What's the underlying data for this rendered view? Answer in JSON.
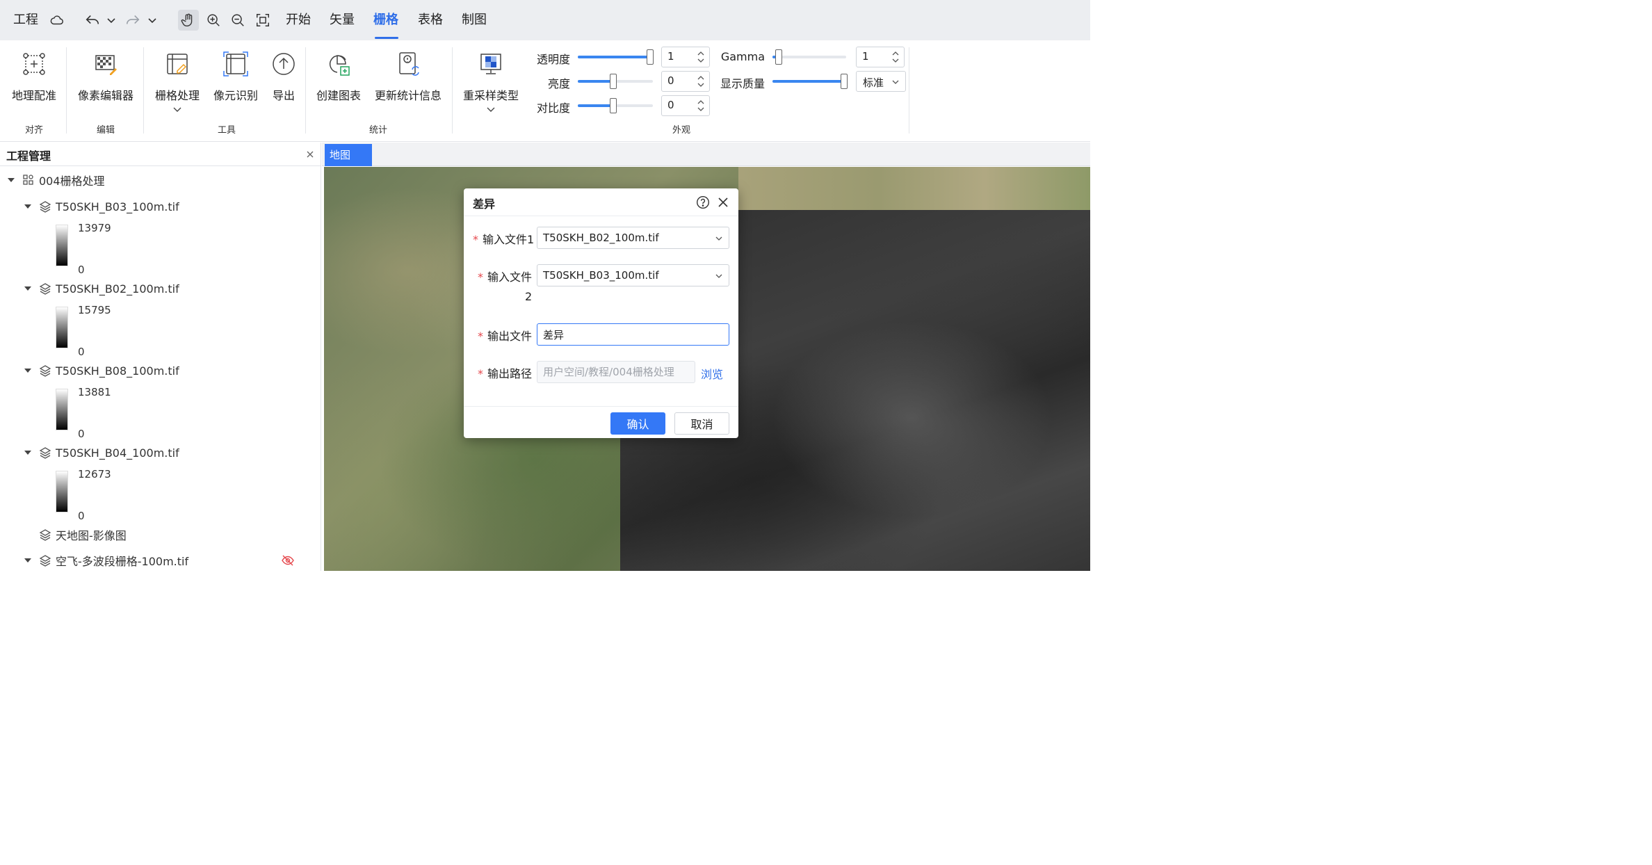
{
  "menubar": {
    "project": "工程",
    "tabs": [
      "开始",
      "矢量",
      "栅格",
      "表格",
      "制图"
    ],
    "active_tab": "栅格"
  },
  "ribbon": {
    "buttons": {
      "georef": "地理配准",
      "pixel_editor": "像素编辑器",
      "raster_processing": "栅格处理",
      "pixel_identify": "像元识别",
      "export": "导出",
      "create_chart": "创建图表",
      "update_stats": "更新统计信息",
      "resample_type": "重采样类型"
    },
    "groups": {
      "align": "对齐",
      "edit": "编辑",
      "tools": "工具",
      "stats": "统计",
      "appearance": "外观"
    },
    "appearance": {
      "transparency_label": "透明度",
      "transparency_value": "1",
      "brightness_label": "亮度",
      "brightness_value": "0",
      "contrast_label": "对比度",
      "contrast_value": "0",
      "gamma_label": "Gamma",
      "gamma_value": "1",
      "quality_label": "显示质量",
      "quality_value": "标准"
    }
  },
  "panel": {
    "title": "工程管理",
    "project_name": "004栅格处理",
    "layers": [
      {
        "name": "T50SKH_B03_100m.tif",
        "max": "13979",
        "min": "0"
      },
      {
        "name": "T50SKH_B02_100m.tif",
        "max": "15795",
        "min": "0"
      },
      {
        "name": "T50SKH_B08_100m.tif",
        "max": "13881",
        "min": "0"
      },
      {
        "name": "T50SKH_B04_100m.tif",
        "max": "12673",
        "min": "0"
      }
    ],
    "basemap": "天地图-影像图",
    "multiband": "空飞-多波段栅格-100m.tif"
  },
  "map": {
    "tab": "地图"
  },
  "dialog": {
    "title": "差异",
    "input1_label": "输入文件1",
    "input1_value": "T50SKH_B02_100m.tif",
    "input2_label": "输入文件",
    "input2_label_wrap": "2",
    "input2_value": "T50SKH_B03_100m.tif",
    "output_label": "输出文件",
    "output_value": "差异",
    "path_label": "输出路径",
    "path_placeholder": "用户空间/教程/004栅格处理",
    "browse": "浏览",
    "ok": "确认",
    "cancel": "取消"
  },
  "colors": {
    "accent": "#3478f6",
    "required": "#e5484d"
  }
}
